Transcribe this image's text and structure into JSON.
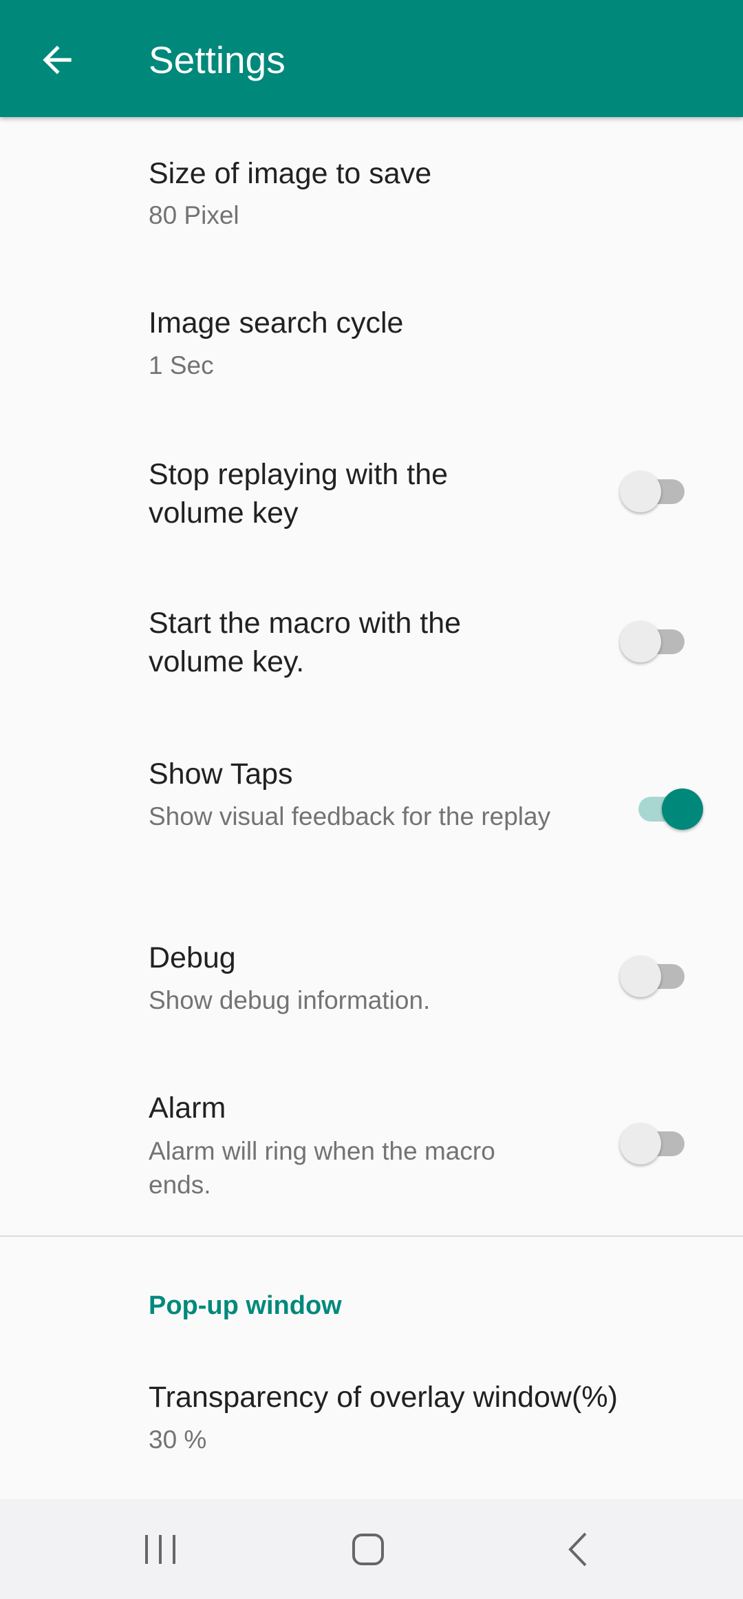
{
  "header": {
    "title": "Settings",
    "back_icon": "arrow-left-icon"
  },
  "items": [
    {
      "title": "Size of image to save",
      "summary": "80 Pixel"
    },
    {
      "title": "Image search cycle",
      "summary": "1 Sec"
    },
    {
      "title": "Stop replaying with the volume key",
      "checked": false
    },
    {
      "title": "Start the macro with the volume key.",
      "checked": false
    },
    {
      "title": "Show Taps",
      "summary": "Show visual feedback for the replay",
      "checked": true
    },
    {
      "title": "Debug",
      "summary": "Show debug information.",
      "checked": false
    },
    {
      "title": "Alarm",
      "summary": "Alarm will ring when the macro ends.",
      "checked": false
    }
  ],
  "category": {
    "title": "Pop-up window"
  },
  "overlay_item": {
    "title": "Transparency of overlay window(%)",
    "summary": "30 %"
  },
  "colors": {
    "accent": "#00897b",
    "accent_light": "#a8d7d2"
  }
}
